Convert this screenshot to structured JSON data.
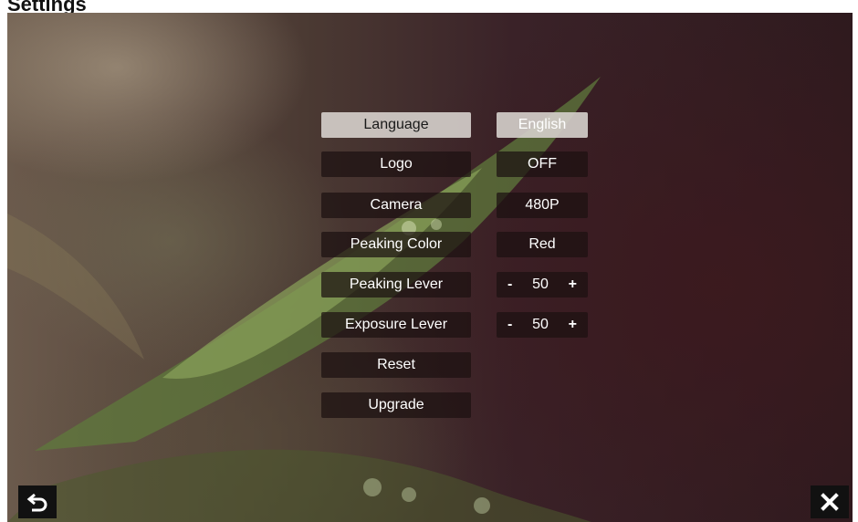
{
  "header": {
    "title": "Settings"
  },
  "menu": [
    {
      "label": "Language",
      "value": "English",
      "selected": true
    },
    {
      "label": "Logo",
      "value": "OFF"
    },
    {
      "label": "Camera",
      "value": "480P"
    },
    {
      "label": "Peaking Color",
      "value": "Red"
    },
    {
      "label": "Peaking Lever",
      "value": "50",
      "minus": "-",
      "plus": "+"
    },
    {
      "label": "Exposure Lever",
      "value": "50",
      "minus": "-",
      "plus": "+"
    },
    {
      "label": "Reset"
    },
    {
      "label": "Upgrade"
    }
  ],
  "icons": {
    "back": "back-arrow-icon",
    "close": "close-icon"
  },
  "colors": {
    "button_bg": "#1c1010",
    "selected_bg": "#d6d0cc",
    "text": "#ffffff"
  }
}
